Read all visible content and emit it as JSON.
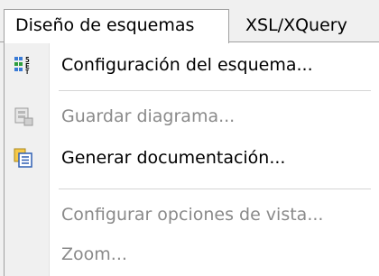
{
  "menubar": {
    "tabs": [
      {
        "label": "Diseño de esquemas",
        "active": true
      },
      {
        "label": "XSL/XQuery",
        "active": false
      }
    ]
  },
  "menu": {
    "items": [
      {
        "label": "Configuración del esquema...",
        "enabled": true,
        "icon": "schema-settings-icon"
      },
      {
        "label": "Guardar diagrama...",
        "enabled": false,
        "icon": "save-diagram-icon"
      },
      {
        "label": "Generar documentación...",
        "enabled": true,
        "icon": "generate-documentation-icon"
      },
      {
        "label": "Configurar opciones de vista...",
        "enabled": false,
        "icon": ""
      },
      {
        "label": "Zoom...",
        "enabled": false,
        "icon": ""
      }
    ]
  },
  "colors": {
    "menu_background": "#f0f0f0",
    "dropdown_background": "#ffffff",
    "disabled_text": "#8a8a8a",
    "border": "#a0a0a0"
  }
}
